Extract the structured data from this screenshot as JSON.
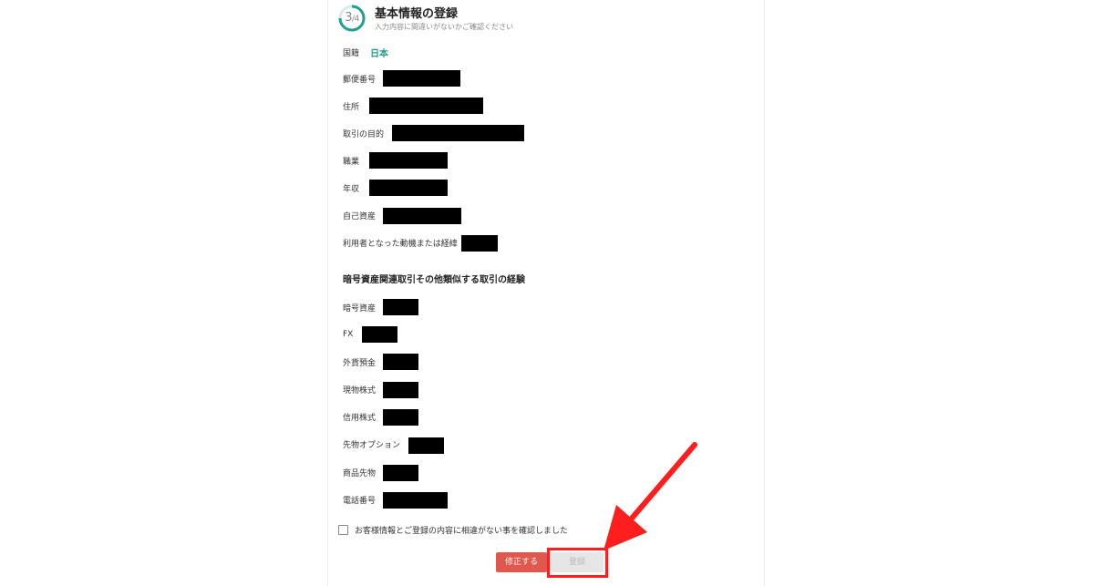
{
  "header": {
    "step_main": "3",
    "step_total": "/4",
    "title": "基本情報の登録",
    "subtitle": "入力内容に間違いがないかご確認ください"
  },
  "fields": [
    {
      "label": "国籍",
      "value": "日本"
    },
    {
      "label": "郵便番号"
    },
    {
      "label": "住所"
    },
    {
      "label": "取引の目的"
    },
    {
      "label": "職業"
    },
    {
      "label": "年収"
    },
    {
      "label": "自己資産"
    },
    {
      "label": "利用者となった動機または経緯"
    }
  ],
  "section": {
    "title": "暗号資産関連取引その他類似する取引の経験"
  },
  "experience": [
    {
      "label": "暗号資産"
    },
    {
      "label": "FX"
    },
    {
      "label": "外貨預金"
    },
    {
      "label": "現物株式"
    },
    {
      "label": "信用株式"
    },
    {
      "label": "先物オプション"
    },
    {
      "label": "商品先物"
    },
    {
      "label": "電話番号"
    }
  ],
  "confirm": {
    "label": "お客様情報とご登録の内容に相違がない事を確認しました",
    "checked": false
  },
  "buttons": {
    "edit": "修正する",
    "register": "登録"
  },
  "colors": {
    "accent": "#20a090",
    "edit_button": "#e0574e",
    "highlight": "#ff1e1e"
  }
}
